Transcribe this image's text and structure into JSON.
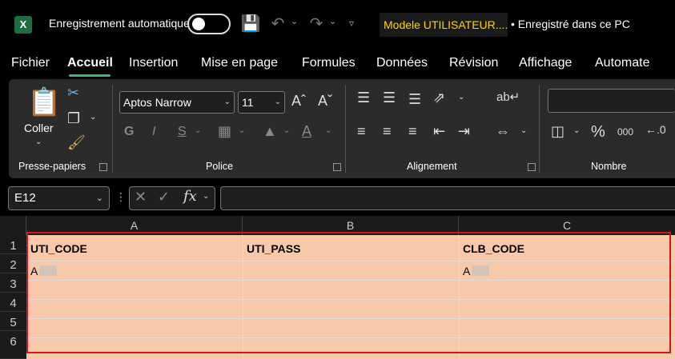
{
  "titlebar": {
    "autosave_label": "Enregistrement automatique",
    "doc_title": "Modele UTILISATEUR....",
    "saved_status": "• Enregistré dans ce PC"
  },
  "tabs": [
    "Fichier",
    "Accueil",
    "Insertion",
    "Mise en page",
    "Formules",
    "Données",
    "Révision",
    "Affichage",
    "Automate"
  ],
  "active_tab": "Accueil",
  "ribbon": {
    "paste_label": "Coller",
    "groups": [
      "Presse-papiers",
      "Police",
      "Alignement",
      "Nombre"
    ],
    "font_name": "Aptos Narrow",
    "font_size": "11",
    "bold": "G",
    "italic": "I",
    "underline": "S",
    "percent": "%",
    "thousands": "000"
  },
  "formula_bar": {
    "name_box": "E12",
    "fx": "fx"
  },
  "sheet": {
    "columns": [
      "A",
      "B",
      "C"
    ],
    "rows": [
      "1",
      "2",
      "3",
      "4",
      "5",
      "6"
    ],
    "cells": {
      "A1": "UTI_CODE",
      "B1": "UTI_PASS",
      "C1": "CLB_CODE",
      "A2": "A",
      "C2": "A"
    }
  },
  "colors": {
    "accent": "#3fb57b",
    "title_highlight": "#ffd400",
    "cell_fill": "#f7c9a9",
    "selection_border": "#d3151c"
  }
}
